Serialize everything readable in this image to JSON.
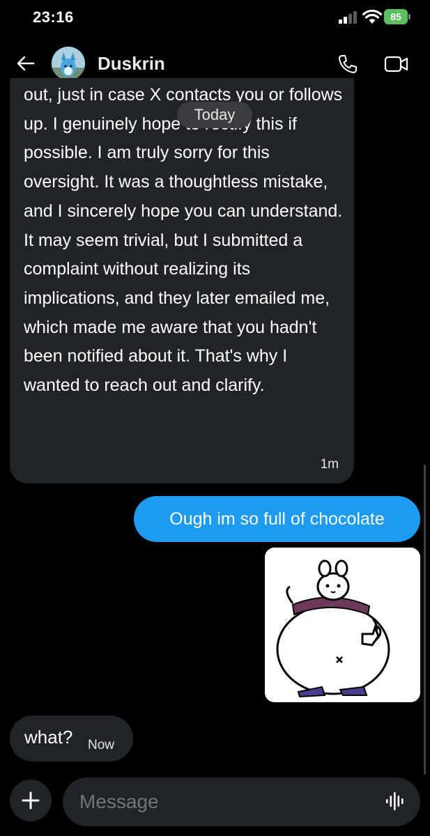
{
  "status_bar": {
    "time": "23:16",
    "battery": "85"
  },
  "header": {
    "contact_name": "Duskrin"
  },
  "messages": {
    "long_text": "out, just in case X contacts you or follows up. I genuinely hope to rectify this if possible. I am truly sorry for this oversight. It was a thoughtless mistake, and I sincerely hope you can understand. It may seem trivial, but I submitted a complaint without realizing its implications, and they later emailed me, which made me aware that you hadn't been notified about it. That's why I wanted to reach out and clarify.",
    "long_time": "1m",
    "date_divider": "Today",
    "outgoing_text": "Ough im so full of chocolate",
    "reply_text": "what?",
    "reply_time": "Now"
  },
  "composer": {
    "placeholder": "Message"
  },
  "colors": {
    "accent": "#1d9bf0",
    "bubble": "#202327",
    "battery": "#5ac05c"
  },
  "icons": [
    "back-arrow-icon",
    "phone-icon",
    "video-camera-icon",
    "plus-icon",
    "voice-waveform-icon",
    "signal-icon",
    "wifi-icon",
    "battery-icon"
  ]
}
